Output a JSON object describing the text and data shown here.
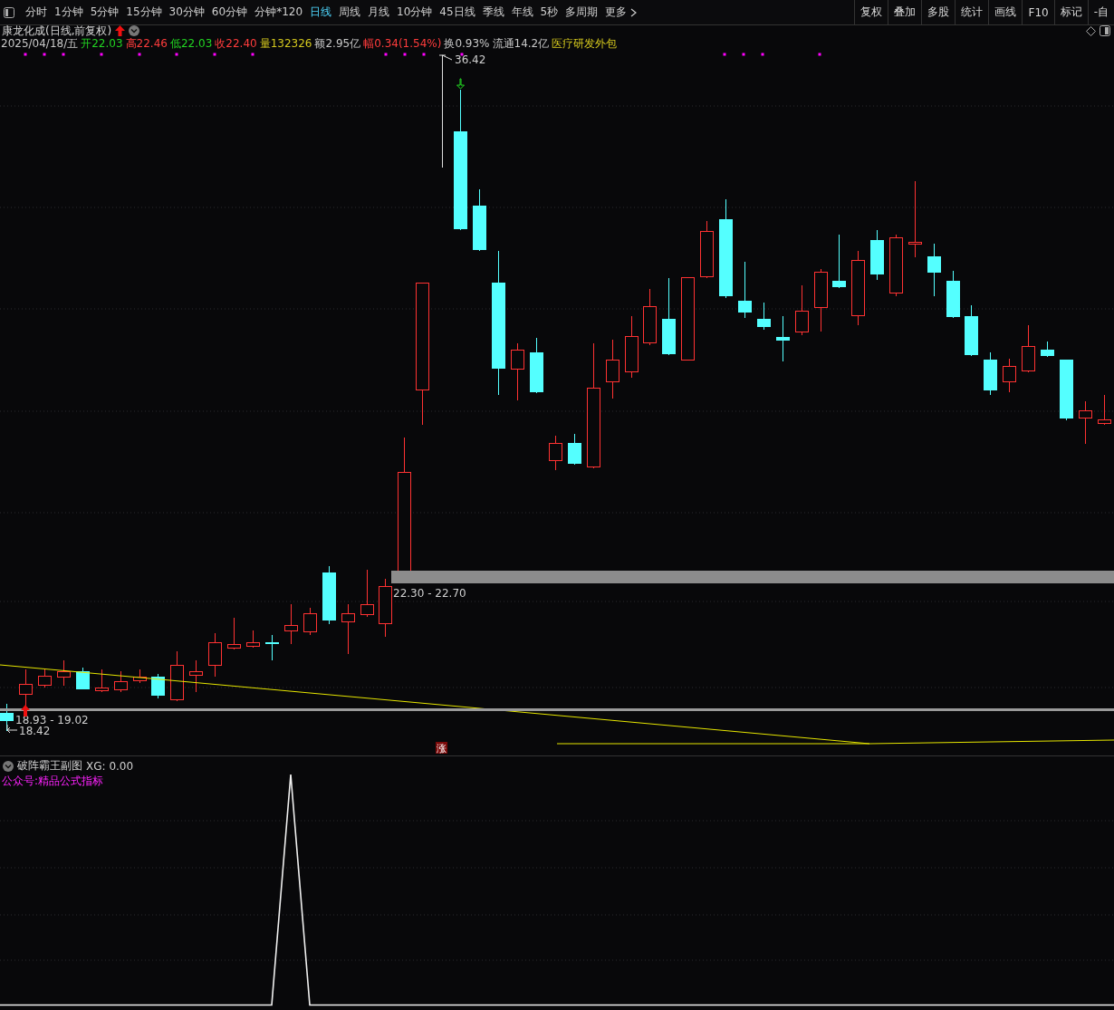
{
  "toolbar": {
    "periods": [
      {
        "label": "分时",
        "selected": false
      },
      {
        "label": "1分钟",
        "selected": false
      },
      {
        "label": "5分钟",
        "selected": false
      },
      {
        "label": "15分钟",
        "selected": false
      },
      {
        "label": "30分钟",
        "selected": false
      },
      {
        "label": "60分钟",
        "selected": false
      },
      {
        "label": "分钟*120",
        "selected": false
      },
      {
        "label": "日线",
        "selected": true
      },
      {
        "label": "周线",
        "selected": false
      },
      {
        "label": "月线",
        "selected": false
      },
      {
        "label": "10分钟",
        "selected": false
      },
      {
        "label": "45日线",
        "selected": false
      },
      {
        "label": "季线",
        "selected": false
      },
      {
        "label": "年线",
        "selected": false
      },
      {
        "label": "5秒",
        "selected": false
      },
      {
        "label": "多周期",
        "selected": false
      }
    ],
    "more": "更多",
    "tools": [
      "复权",
      "叠加",
      "多股",
      "统计",
      "画线",
      "F10",
      "标记",
      "-自"
    ]
  },
  "stock": {
    "title": "康龙化成(日线,前复权)",
    "info": [
      {
        "text": "2025/04/18/五",
        "color": "#c8c8c8"
      },
      {
        "text": "开22.03",
        "color": "#22d422"
      },
      {
        "text": "高22.46",
        "color": "#ff3c3c"
      },
      {
        "text": "低22.03",
        "color": "#22d422"
      },
      {
        "text": "收22.40",
        "color": "#ff3c3c"
      },
      {
        "text": "量132326",
        "color": "#d4c81e"
      },
      {
        "text": "额2.95亿",
        "color": "#c8c8c8"
      },
      {
        "text": "幅0.34(1.54%)",
        "color": "#ff3c3c"
      },
      {
        "text": "换0.93%",
        "color": "#c8c8c8"
      },
      {
        "text": "流通14.2亿",
        "color": "#c8c8c8"
      },
      {
        "text": "医疗研发外包",
        "color": "#d4c81e"
      }
    ]
  },
  "chart": {
    "high_label": "36.42",
    "zone_labels": [
      "22.30 - 22.70",
      "18.93 - 19.02"
    ],
    "low_label": "18.42",
    "badge": "涨"
  },
  "indicator": {
    "title": "破阵霸王副图",
    "value": "XG: 0.00",
    "note": "公众号:精品公式指标"
  }
}
